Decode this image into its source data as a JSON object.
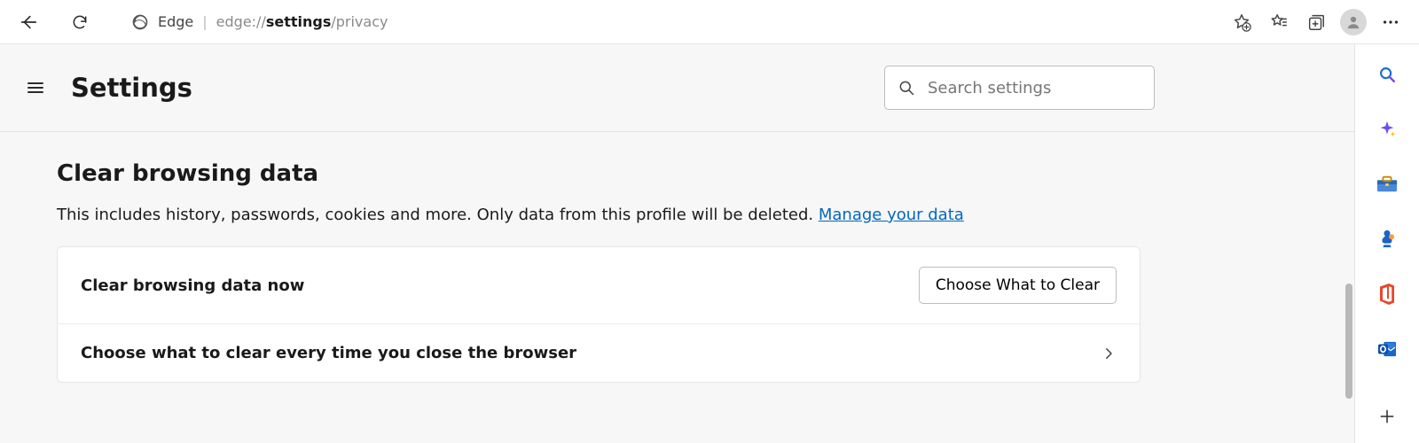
{
  "chrome": {
    "site_label": "Edge",
    "url_prefix": "edge://",
    "url_bold": "settings",
    "url_suffix": "/privacy"
  },
  "header": {
    "title": "Settings",
    "search_placeholder": "Search settings"
  },
  "section": {
    "title": "Clear browsing data",
    "desc_text": "This includes history, passwords, cookies and more. Only data from this profile will be deleted. ",
    "desc_link": "Manage your data",
    "rows": [
      {
        "label": "Clear browsing data now",
        "action_label": "Choose What to Clear"
      },
      {
        "label": "Choose what to clear every time you close the browser"
      }
    ]
  }
}
